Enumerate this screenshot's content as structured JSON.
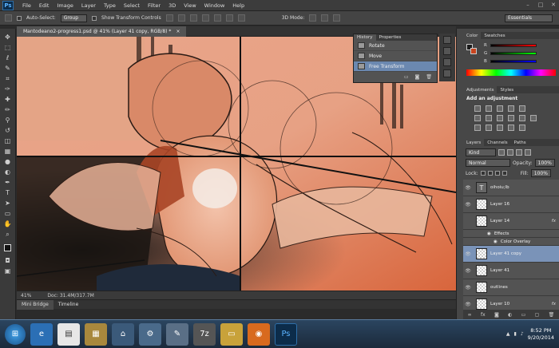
{
  "app": {
    "logo": "Ps"
  },
  "menu": [
    "File",
    "Edit",
    "Image",
    "Layer",
    "Type",
    "Select",
    "Filter",
    "3D",
    "View",
    "Window",
    "Help"
  ],
  "options": {
    "auto_select_label": "Auto-Select:",
    "auto_select_value": "Group",
    "show_transform_label": "Show Transform Controls",
    "mode_3d_label": "3D Mode:",
    "workspace": "Essentials"
  },
  "document": {
    "tab_title": "Mantodeano2-progress1.psd @ 41% (Layer 41 copy, RGB/8) *",
    "zoom": "41%",
    "doc_size": "Doc: 31.4M/317.7M"
  },
  "bottom_tabs": [
    "Mini Bridge",
    "Timeline"
  ],
  "history": {
    "tabs": [
      "History",
      "Properties"
    ],
    "items": [
      {
        "label": "Rotate",
        "selected": false
      },
      {
        "label": "Move",
        "selected": false
      },
      {
        "label": "Free Transform",
        "selected": true
      }
    ]
  },
  "color_panel": {
    "tabs": [
      "Color",
      "Swatches"
    ],
    "fg": "#1a1a1a",
    "bg": "#c8441e"
  },
  "adjustments": {
    "tabs": [
      "Adjustments",
      "Styles"
    ],
    "heading": "Add an adjustment"
  },
  "layers": {
    "tabs": [
      "Layers",
      "Channels",
      "Paths"
    ],
    "kind": "Kind",
    "blend": "Normal",
    "opacity_label": "Opacity:",
    "opacity": "100%",
    "lock_label": "Lock:",
    "fill_label": "Fill:",
    "fill": "100%",
    "rows": [
      {
        "name": "oihoiu;lb",
        "type": "text"
      },
      {
        "name": "Layer 16",
        "type": "pixel"
      },
      {
        "name": "Layer 14",
        "type": "pixel",
        "fx": "fx"
      },
      {
        "name": "Layer 41 copy",
        "type": "pixel",
        "selected": true
      },
      {
        "name": "Layer 41",
        "type": "pixel"
      },
      {
        "name": "outlines",
        "type": "pixel"
      },
      {
        "name": "Layer 10",
        "type": "pixel",
        "fx": "fx"
      }
    ],
    "effects_label": "Effects",
    "color_overlay_label": "Color Overlay"
  },
  "taskbar": {
    "time": "8:52 PM",
    "date": "9/20/2014"
  }
}
